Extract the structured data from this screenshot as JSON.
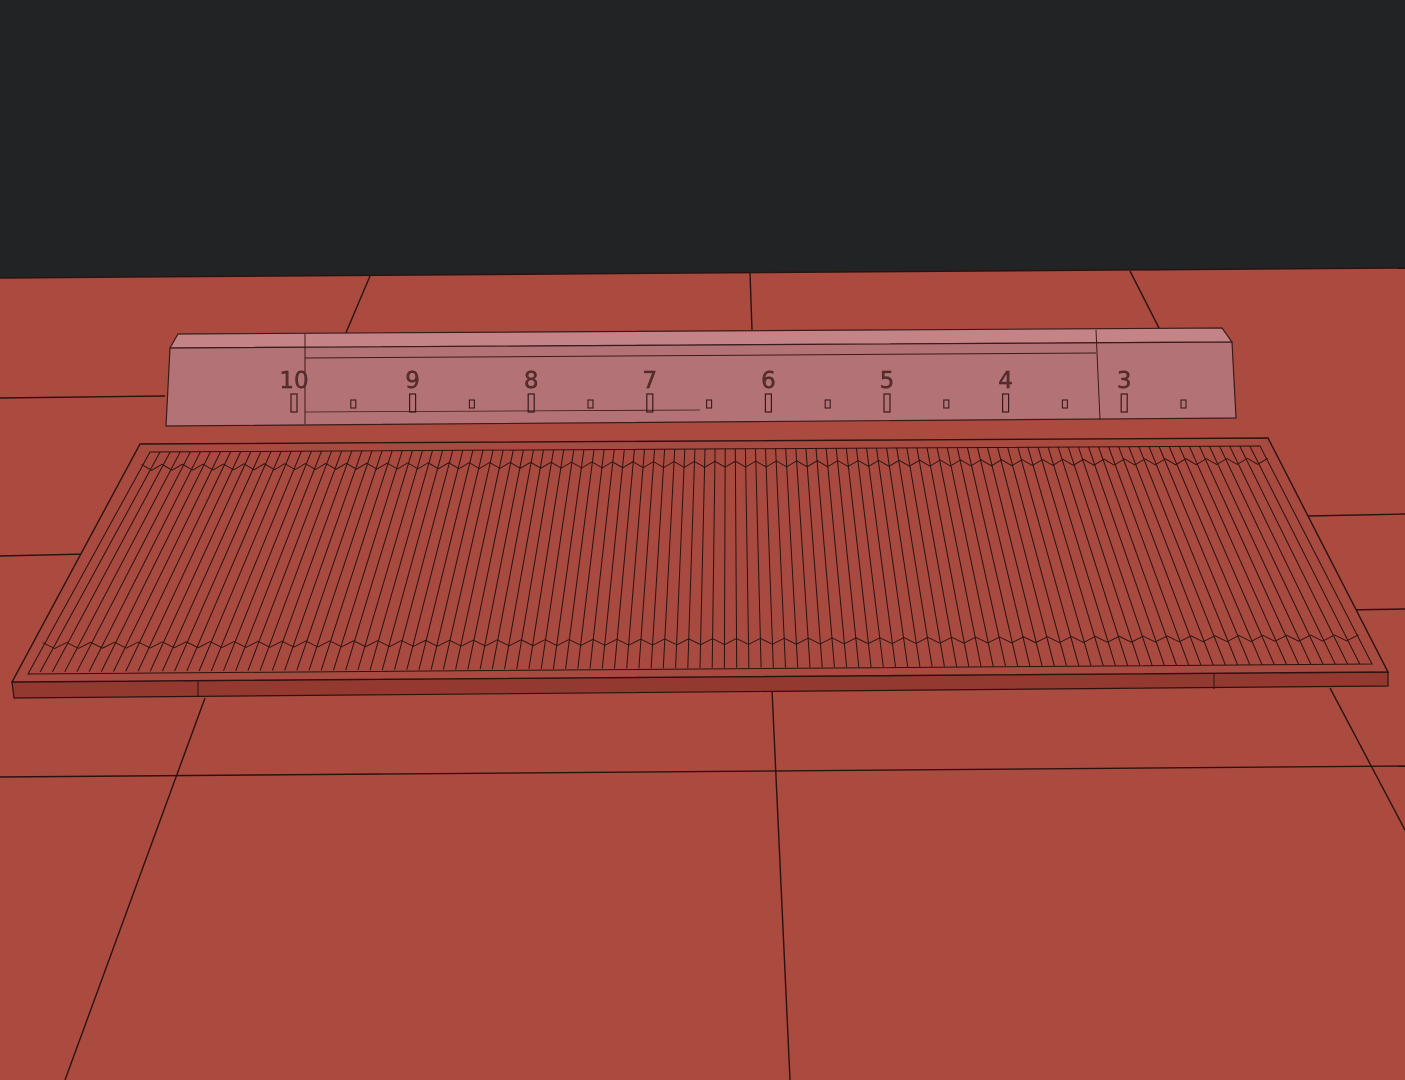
{
  "viewport": {
    "background_color": "#222325",
    "floor_color": "#ab4b3f",
    "wire_color": "#2a1210"
  },
  "ruler": {
    "body_color": "#b37376",
    "labels": [
      "10",
      "9",
      "8",
      "7",
      "6",
      "5",
      "4",
      "3"
    ]
  },
  "mat": {
    "top_color": "#a84a3f",
    "side_color": "#93392f"
  }
}
